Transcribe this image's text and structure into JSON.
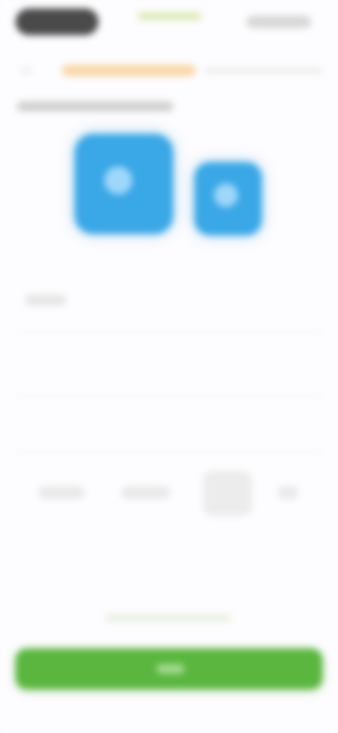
{
  "colors": {
    "background": "#fdfcfe",
    "status_pill": "#4a4a4a",
    "highlight": "#f9d7a8",
    "tile_accent": "#3aa7e6",
    "primary_button": "#5ab63f"
  },
  "header": {
    "left_control_icon": "status-pill",
    "right_control_icon": "menu-capsule"
  },
  "tiles": [
    {
      "icon": "app-tile-icon"
    },
    {
      "icon": "app-tile-icon"
    }
  ],
  "tabs": [
    {
      "icon": "tab-icon"
    },
    {
      "icon": "tab-icon"
    },
    {
      "icon": "tab-icon",
      "selected": true
    },
    {
      "icon": "tab-icon"
    }
  ]
}
